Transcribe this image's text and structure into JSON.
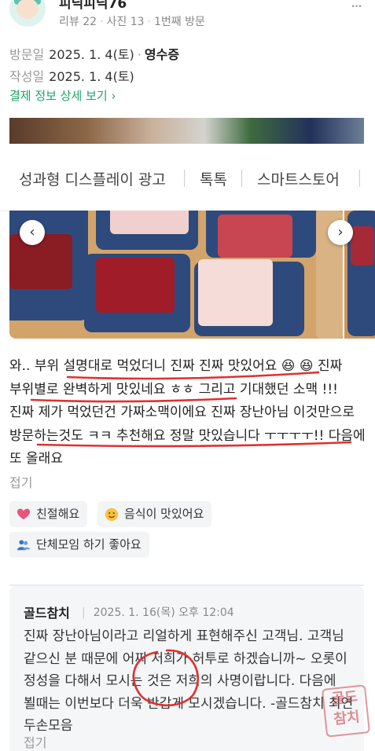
{
  "profile": {
    "nickname": "피닉피닉76",
    "reviews": "리뷰 22",
    "photos": "사진 13",
    "visit_count": "1번째 방문",
    "more_glyph": "···"
  },
  "visit": {
    "visit_label": "방문일",
    "visit_date": "2025. 1. 4(토)",
    "receipt": "영수증",
    "write_label": "작성일",
    "write_date": "2025. 1. 4(토)",
    "payment_link": "결제 정보 상세 보기 ›"
  },
  "ad_bar": {
    "items": [
      "성과형 디스플레이 광고",
      "톡톡",
      "스마트스토어"
    ]
  },
  "gallery": {
    "prev_glyph": "‹",
    "next_glyph": "›"
  },
  "review": {
    "text": "와.. 부위 설명대로 먹었더니 진짜 진짜 맛있어요 😆 😆 진짜 부위별로 완벽하게 맛있네요 ㅎㅎ 그리고 기대했던 소맥 !!! 진짜 제가 먹었던건 가짜소맥이에요 진짜 장난아님 이것만으로 방문하는것도 ㅋㅋ 추천해요 정말 맛있습니다 ㅜㅜㅜㅜ!! 다음에 또 올래요",
    "fold": "접기"
  },
  "keywords": [
    {
      "label": "친절해요",
      "icon": "heart-icon"
    },
    {
      "label": "음식이 맛있어요",
      "icon": "yum-face-icon"
    },
    {
      "label": "단체모임 하기 좋아요",
      "icon": "group-icon"
    }
  ],
  "reply": {
    "name": "골드참치",
    "date": "2025. 1. 16(목) 오후 12:04",
    "text": "진짜 장난아님이라고 리얼하게 표현해주신 고객님. 고객님 같으신 분 때문에 어찌 저희가 허투로 하겠습니까~ 오롯이 정성을 다해서 모시는 것은 저희의 사명이랍니다. 다음에 뵐때는 이번보다 더욱 반갑게 모시겠습니다. -골드참치 최연 두손모음",
    "fold": "접기"
  },
  "watermark": {
    "text": "골드 참치"
  },
  "colors": {
    "accent_green": "#1ea366",
    "annotation_red": "#e03030",
    "chip_bg": "#f3f4f6",
    "reply_bg": "#f5f6f8"
  }
}
